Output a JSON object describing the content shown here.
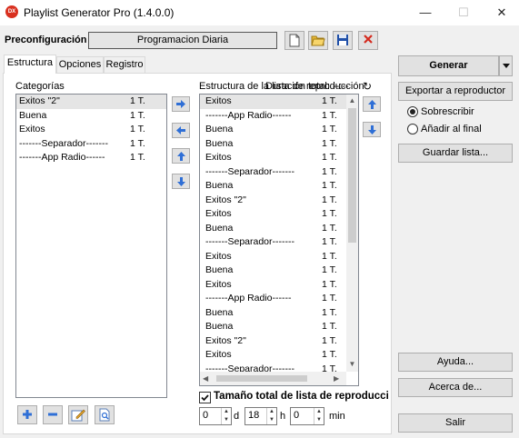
{
  "window": {
    "title": "Playlist Generator Pro (1.4.0.0)",
    "icon_text": "DX",
    "minimize": "—",
    "maximize": "☐",
    "close": "✕"
  },
  "preset": {
    "label": "Preconfiguración",
    "value": "Programacion Diaria"
  },
  "tabs": [
    "Estructura",
    "Opciones",
    "Registro"
  ],
  "categories": {
    "label": "Categorías",
    "items": [
      {
        "name": "Exitos \"2\"",
        "count": "1 T."
      },
      {
        "name": "Buena",
        "count": "1 T."
      },
      {
        "name": "Exitos",
        "count": "1 T."
      },
      {
        "name": "-------Separador-------",
        "count": "1 T."
      },
      {
        "name": "-------App Radio------",
        "count": "1 T."
      }
    ]
  },
  "structure": {
    "label": "Estructura de la lista de reproducción",
    "overlap_label": "Duración total: --:--",
    "refresh": "↻",
    "items": [
      {
        "name": "Exitos",
        "count": "1 T."
      },
      {
        "name": "-------App Radio------",
        "count": "1 T."
      },
      {
        "name": "Buena",
        "count": "1 T."
      },
      {
        "name": "Buena",
        "count": "1 T."
      },
      {
        "name": "Exitos",
        "count": "1 T."
      },
      {
        "name": "-------Separador-------",
        "count": "1 T."
      },
      {
        "name": "Buena",
        "count": "1 T."
      },
      {
        "name": "Exitos \"2\"",
        "count": "1 T."
      },
      {
        "name": "Exitos",
        "count": "1 T."
      },
      {
        "name": "Buena",
        "count": "1 T."
      },
      {
        "name": "-------Separador-------",
        "count": "1 T."
      },
      {
        "name": "Exitos",
        "count": "1 T."
      },
      {
        "name": "Buena",
        "count": "1 T."
      },
      {
        "name": "Exitos",
        "count": "1 T."
      },
      {
        "name": "-------App Radio------",
        "count": "1 T."
      },
      {
        "name": "Buena",
        "count": "1 T."
      },
      {
        "name": "Buena",
        "count": "1 T."
      },
      {
        "name": "Exitos \"2\"",
        "count": "1 T."
      },
      {
        "name": "Exitos",
        "count": "1 T."
      },
      {
        "name": "-------Separador-------",
        "count": "1 T."
      }
    ]
  },
  "size": {
    "checkbox_label": "Tamaño total de lista de reproducción",
    "checked": true,
    "days": "0",
    "days_unit": "d",
    "hours": "18",
    "hours_unit": "h",
    "minutes": "0",
    "minutes_unit": "min"
  },
  "right": {
    "generate": "Generar",
    "export": "Exportar a reproductor",
    "overwrite": "Sobrescribir",
    "append": "Añadir al final",
    "save": "Guardar lista...",
    "help": "Ayuda...",
    "about": "Acerca de...",
    "exit": "Salir"
  }
}
